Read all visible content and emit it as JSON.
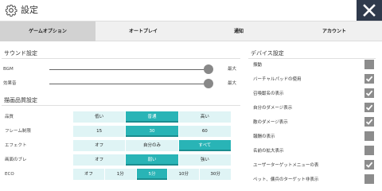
{
  "header": {
    "title": "設定",
    "gear_icon": "gear-icon",
    "close_icon": "close-icon"
  },
  "tabs": [
    {
      "label": "ゲームオプション",
      "active": true
    },
    {
      "label": "オートプレイ",
      "active": false
    },
    {
      "label": "通知",
      "active": false
    },
    {
      "label": "アカウント",
      "active": false
    }
  ],
  "sound": {
    "section_title": "サウンド設定",
    "sliders": [
      {
        "label": "BGM",
        "max_label": "最大",
        "value": 1.0
      },
      {
        "label": "効果音",
        "max_label": "最大",
        "value": 1.0
      }
    ]
  },
  "graphics": {
    "section_title": "描画品質設定",
    "rows": [
      {
        "label": "品質",
        "options": [
          "低い",
          "普通",
          "高い"
        ],
        "selected": 1
      },
      {
        "label": "フレーム制限",
        "options": [
          "15",
          "30",
          "60"
        ],
        "selected": 1
      },
      {
        "label": "エフェクト",
        "options": [
          "オフ",
          "自分のみ",
          "すべて"
        ],
        "selected": 2
      },
      {
        "label": "画面のブレ",
        "options": [
          "オフ",
          "弱い",
          "強い"
        ],
        "selected": 1
      },
      {
        "label": "ECO",
        "options": [
          "オフ",
          "1分",
          "5分",
          "10分",
          "30分"
        ],
        "selected": 2
      }
    ]
  },
  "device": {
    "section_title": "デバイス設定",
    "items": [
      {
        "label": "振動",
        "checked": false
      },
      {
        "label": "バーチャルパッドの使用",
        "checked": true
      },
      {
        "label": "召喚獣名の表示",
        "checked": true
      },
      {
        "label": "自分のダメージ表示",
        "checked": true
      },
      {
        "label": "敵のダメージ表示",
        "checked": true
      },
      {
        "label": "報酬の表示",
        "checked": false
      },
      {
        "label": "名前の拡大表示",
        "checked": false
      },
      {
        "label": "ユーザーターゲットメニューの表",
        "checked": true
      },
      {
        "label": "ペット、傭兵のターゲット非表示",
        "checked": false
      }
    ]
  },
  "colors": {
    "accent": "#29b4b6",
    "accent_light": "#dff4f5",
    "checkbox": "#8c8c8c",
    "close_bg": "#2f3a4c"
  }
}
